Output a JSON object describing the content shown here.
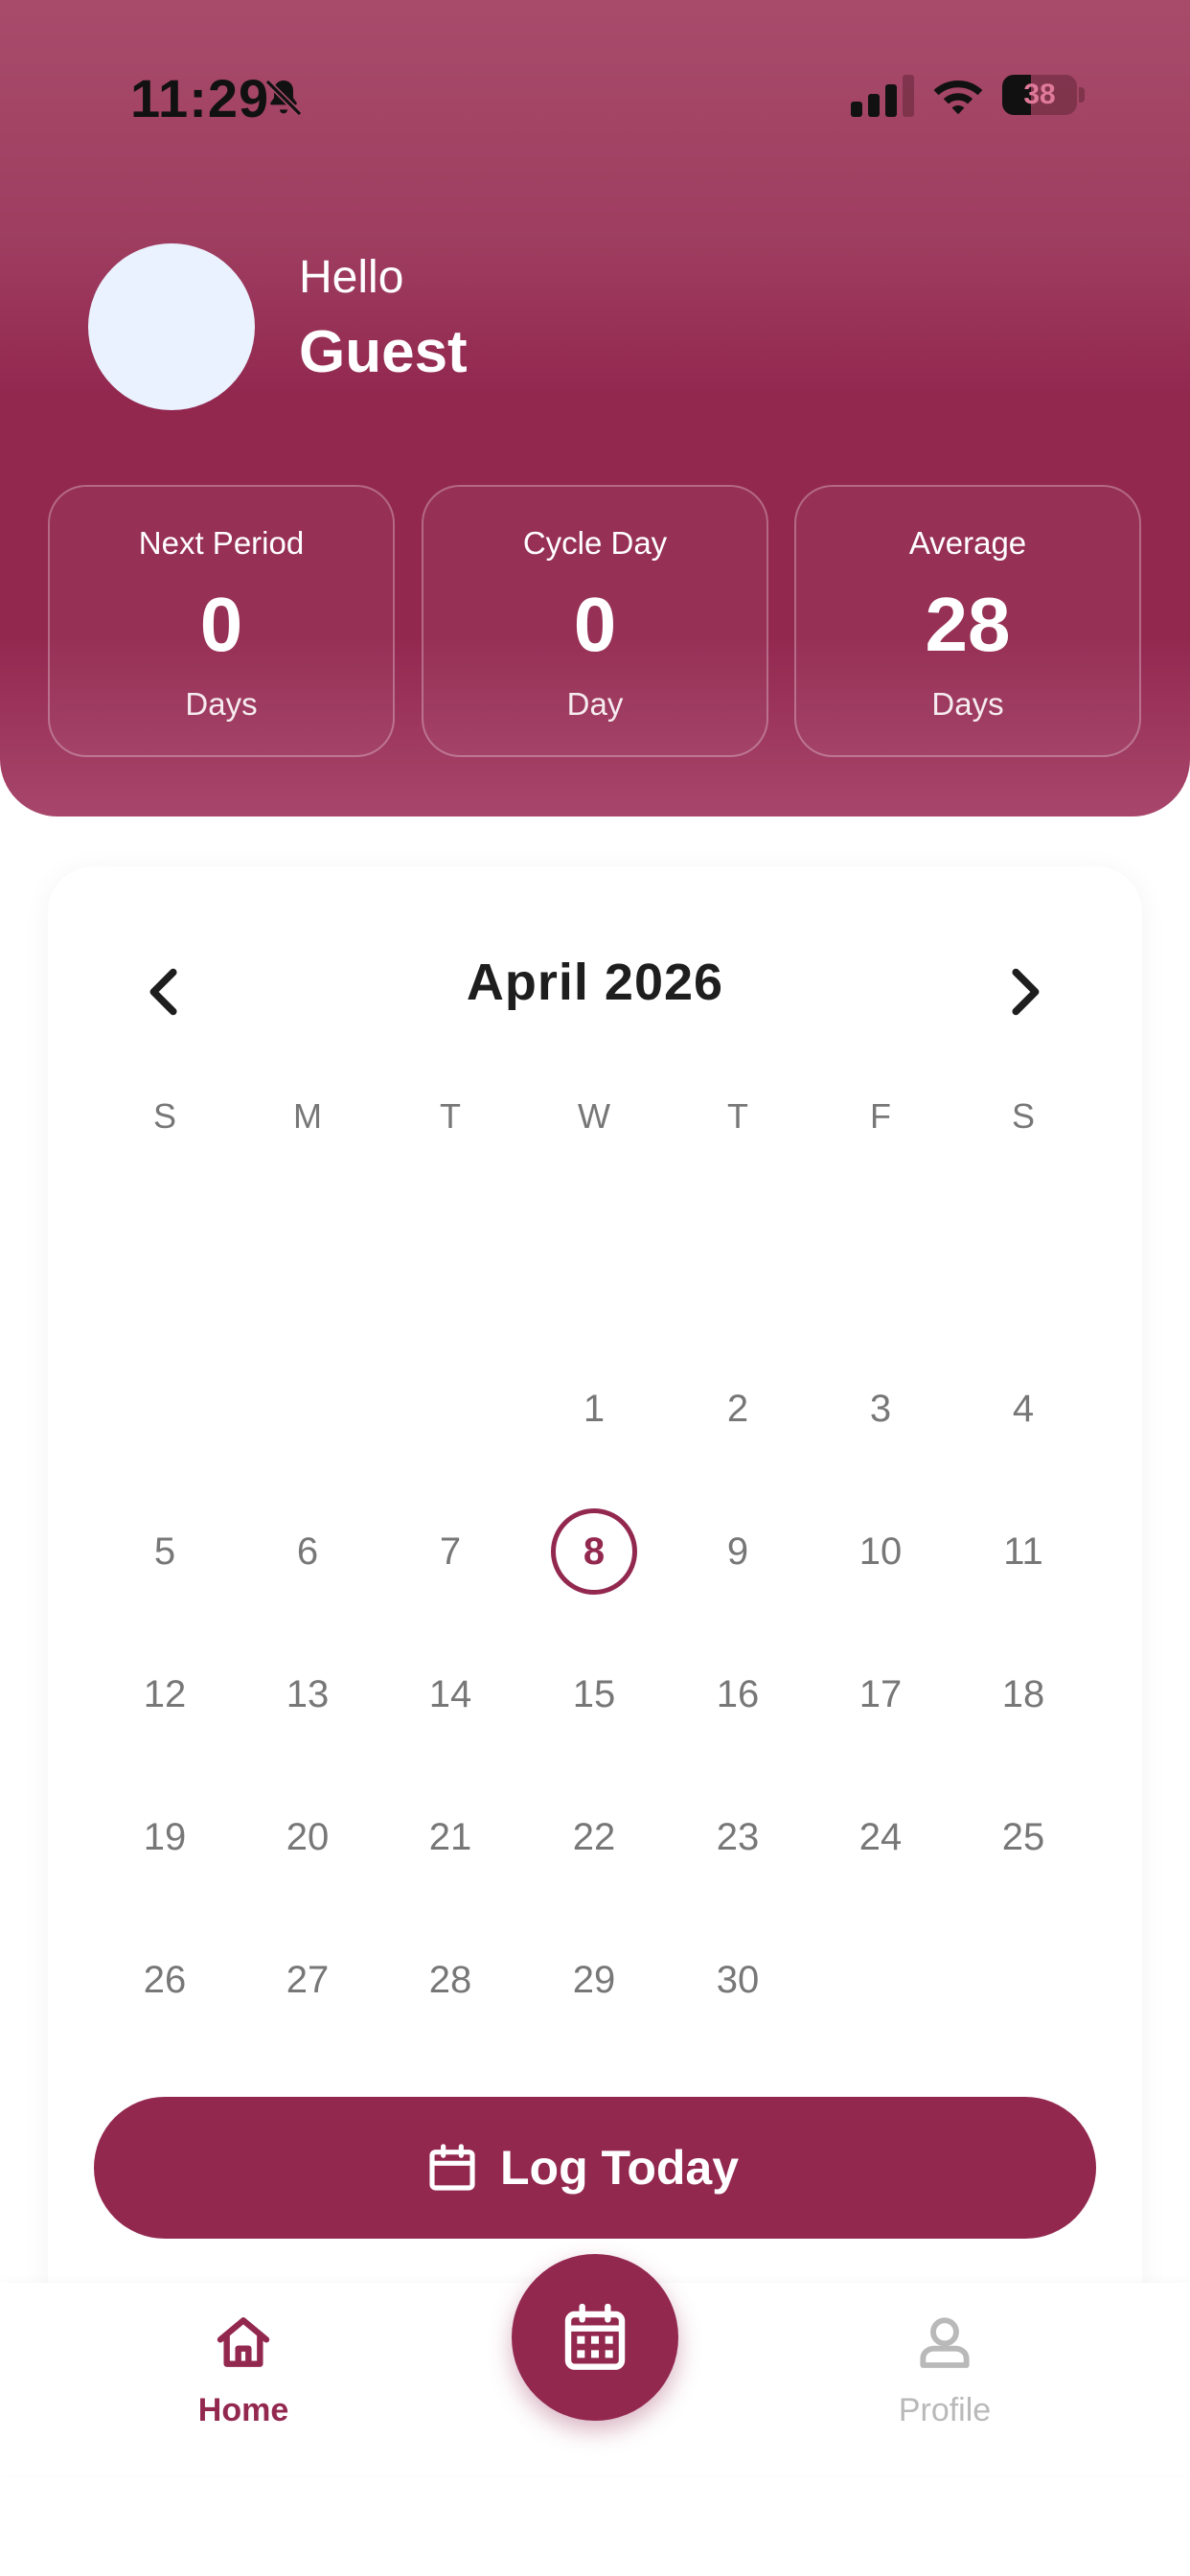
{
  "status_bar": {
    "time": "11:29",
    "battery": "38",
    "battery_level": 0.38
  },
  "header": {
    "greeting": "Hello",
    "username": "Guest"
  },
  "stats": [
    {
      "label": "Next Period",
      "value": "0",
      "unit": "Days"
    },
    {
      "label": "Cycle Day",
      "value": "0",
      "unit": "Day"
    },
    {
      "label": "Average",
      "value": "28",
      "unit": "Days"
    }
  ],
  "calendar": {
    "title": "April 2026",
    "weekdays": [
      "S",
      "M",
      "T",
      "W",
      "T",
      "F",
      "S"
    ],
    "first_weekday_index": 3,
    "days": [
      "1",
      "2",
      "3",
      "4",
      "5",
      "6",
      "7",
      "8",
      "9",
      "10",
      "11",
      "12",
      "13",
      "14",
      "15",
      "16",
      "17",
      "18",
      "19",
      "20",
      "21",
      "22",
      "23",
      "24",
      "25",
      "26",
      "27",
      "28",
      "29",
      "30"
    ],
    "today": "8"
  },
  "log_button": {
    "label": "Log Today"
  },
  "bottom_nav": {
    "home_label": "Home",
    "profile_label": "Profile"
  },
  "colors": {
    "primary": "#93284f",
    "avatar_bg": "#eaf2ff",
    "muted_text": "#777777"
  }
}
